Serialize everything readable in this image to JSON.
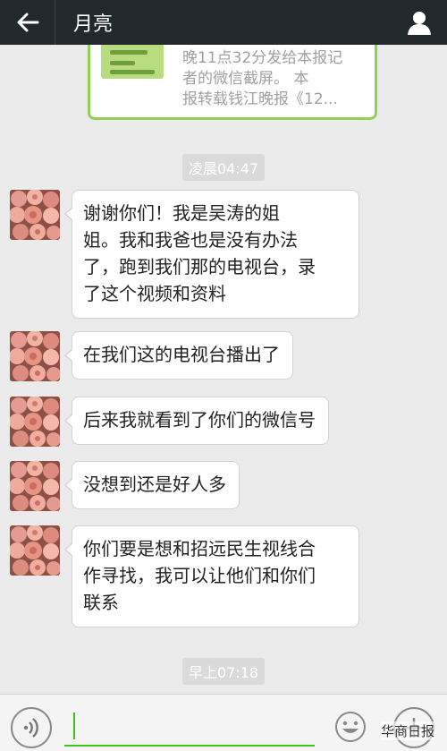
{
  "header": {
    "title": "月亮",
    "back_icon": "arrow-left-icon",
    "profile_icon": "person-icon"
  },
  "shared_card": {
    "lines": [
      "晚11点32分发给本报记",
      "者的微信截屏。   本",
      "报转载钱江晚报《12..."
    ]
  },
  "timestamps": {
    "first": "凌晨04:47",
    "second": "早上07:18"
  },
  "messages": [
    {
      "lines": [
        "谢谢你们！我是吴涛的姐",
        "姐。我和我爸也是没有办法",
        "了，跑到我们那的电视台，录",
        "了这个视频和资料"
      ]
    },
    {
      "lines": [
        "在我们这的电视台播出了"
      ]
    },
    {
      "lines": [
        "后来我就看到了你们的微信号"
      ]
    },
    {
      "lines": [
        "没想到还是好人多"
      ]
    },
    {
      "lines": [
        "你们要是想和招远民生视线合",
        "作寻找，我可以让他们和你们",
        "联系"
      ]
    }
  ],
  "inputbar": {
    "voice_icon": "voice-icon",
    "emoji_icon": "emoji-icon",
    "plus_icon": "plus-icon",
    "input_value": ""
  },
  "watermark": "华商日报",
  "colors": {
    "header_bg": "#22292c",
    "chat_bg": "#ebebeb",
    "accent_green": "#45c01a",
    "card_border": "#8fd055"
  }
}
